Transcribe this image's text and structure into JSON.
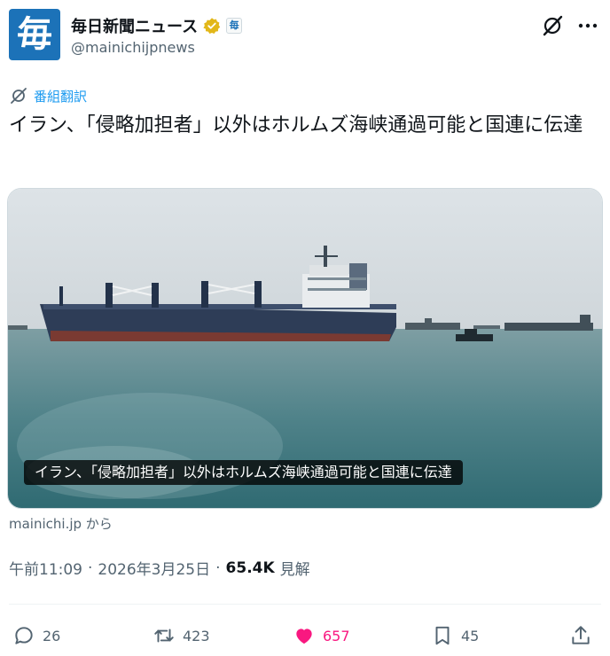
{
  "account": {
    "avatar_char": "毎",
    "display_name": "毎日新聞ニュース",
    "handle": "@mainichijpnews",
    "affiliate_badge": "毎"
  },
  "translate_label": "番組翻訳",
  "tweet_text": "イラン、「侵略加担者」以外はホルムズ海峡通過可能と国連に伝達",
  "media_caption": "イラン、「侵略加担者」以外はホルムズ海峡通過可能と国連に伝達",
  "source_text": "mainichi.jp から",
  "meta": {
    "time": "午前11:09",
    "sep": "·",
    "date": "2026年3月25日",
    "sep2": "·",
    "views": "65.4K",
    "views_label": "見解"
  },
  "actions": {
    "replies": "26",
    "reposts": "423",
    "likes": "657",
    "bookmarks": "45"
  },
  "colors": {
    "brand": "#1c72b8",
    "link": "#1d9bf0",
    "like": "#f91880",
    "muted": "#536471"
  }
}
